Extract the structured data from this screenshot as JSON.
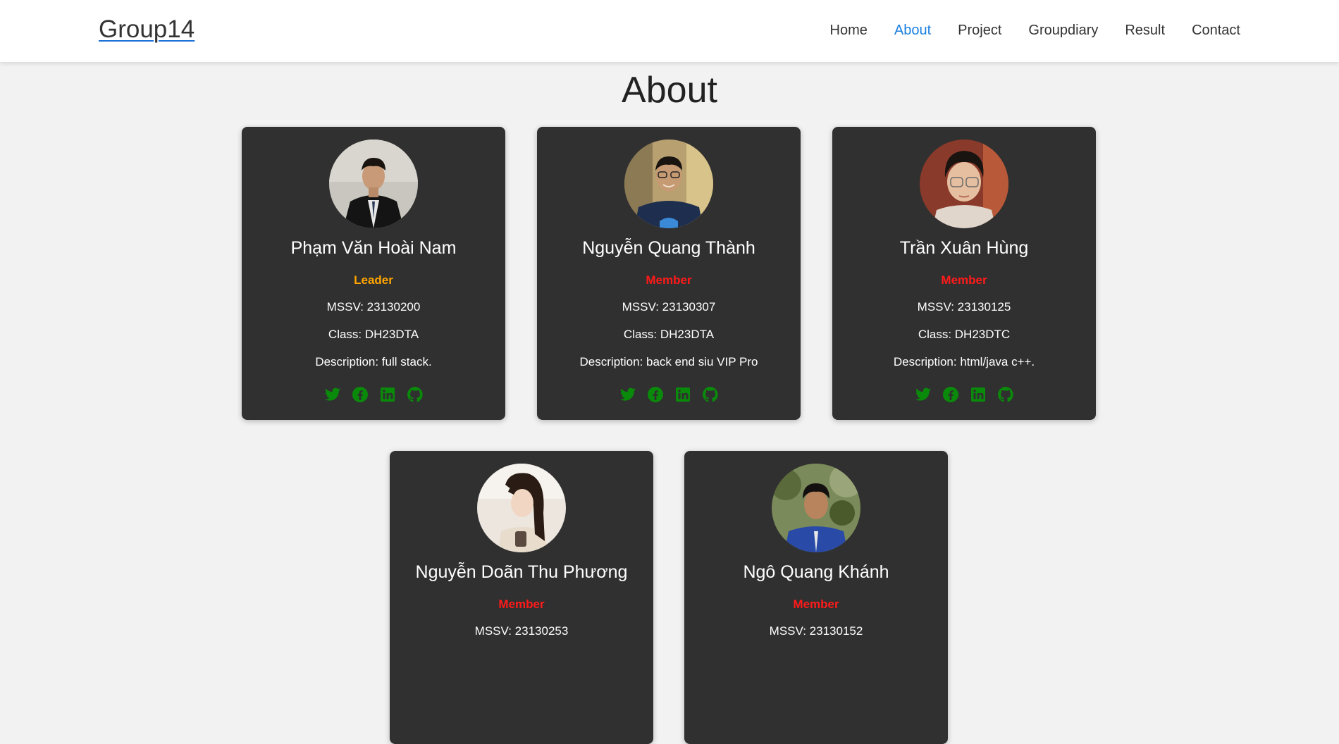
{
  "header": {
    "brand": "Group14",
    "nav": [
      {
        "label": "Home",
        "active": false
      },
      {
        "label": "About",
        "active": true
      },
      {
        "label": "Project",
        "active": false
      },
      {
        "label": "Groupdiary",
        "active": false
      },
      {
        "label": "Result",
        "active": false
      },
      {
        "label": "Contact",
        "active": false
      }
    ]
  },
  "main": {
    "title": "About",
    "members": [
      {
        "name": "Phạm Văn Hoài Nam",
        "role": "Leader",
        "mssv": "MSSV: 23130200",
        "class": "Class: DH23DTA",
        "description": "Description: full stack."
      },
      {
        "name": "Nguyễn Quang Thành",
        "role": "Member",
        "mssv": "MSSV: 23130307",
        "class": "Class: DH23DTA",
        "description": "Description: back end siu VIP Pro"
      },
      {
        "name": "Trần Xuân Hùng",
        "role": "Member",
        "mssv": "MSSV: 23130125",
        "class": "Class: DH23DTC",
        "description": "Description: html/java c++."
      },
      {
        "name": "Nguyễn Doãn Thu Phương",
        "role": "Member",
        "mssv": "MSSV: 23130253",
        "class": "",
        "description": ""
      },
      {
        "name": "Ngô Quang Khánh",
        "role": "Member",
        "mssv": "MSSV: 23130152",
        "class": "",
        "description": ""
      }
    ],
    "social_icons": [
      "twitter-icon",
      "facebook-icon",
      "linkedin-icon",
      "github-icon"
    ]
  },
  "colors": {
    "nav_active": "#1a7fe0",
    "card_bg": "#303030",
    "leader": "#ffa500",
    "member": "#ff1a1a",
    "social": "#0a8a0a"
  }
}
